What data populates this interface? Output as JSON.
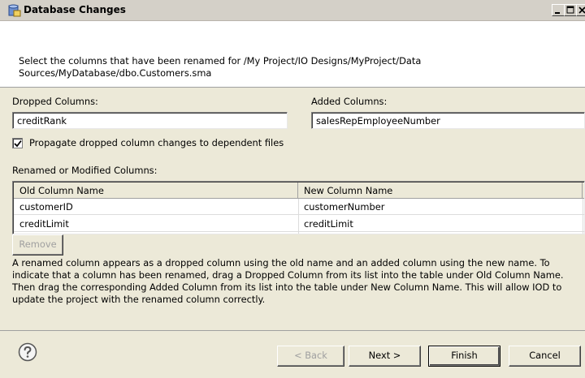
{
  "window": {
    "title": "Database Changes",
    "icon": "database-icon",
    "controls": {
      "minimize": "minimize-icon",
      "maximize": "maximize-icon",
      "close": "close-icon"
    }
  },
  "banner": {
    "message": "Select the columns that have been renamed for /My Project/IO Designs/MyProject/Data Sources/MyDatabase/dbo.Customers.sma"
  },
  "dropped": {
    "label": "Dropped Columns:",
    "value": "creditRank"
  },
  "added": {
    "label": "Added Columns:",
    "value": "salesRepEmployeeNumber"
  },
  "propagate": {
    "label": "Propagate dropped column changes to dependent files",
    "checked": true
  },
  "renamed": {
    "label": "Renamed or Modified Columns:",
    "columns": [
      "Old Column Name",
      "New Column Name"
    ],
    "rows": [
      [
        "customerID",
        "customerNumber"
      ],
      [
        "creditLimit",
        "creditLimit"
      ]
    ]
  },
  "remove_label": "Remove",
  "description": "A renamed column appears as a dropped column using the old name and an added column using the new name. To indicate that a column has been renamed, drag a Dropped Column from its list into the table under Old Column Name.  Then drag the corresponding Added Column from its list into the table under New Column Name.  This will allow IOD to update the project with the renamed column correctly.",
  "footer": {
    "help_icon": "help-icon",
    "back_label": "< Back",
    "next_label": "Next >",
    "finish_label": "Finish",
    "cancel_label": "Cancel"
  },
  "colors": {
    "title_bar": "#d4d0c8",
    "dialog_face": "#ece9d8",
    "banner": "#ffffff",
    "disabled_text": "#a0a0a0"
  }
}
